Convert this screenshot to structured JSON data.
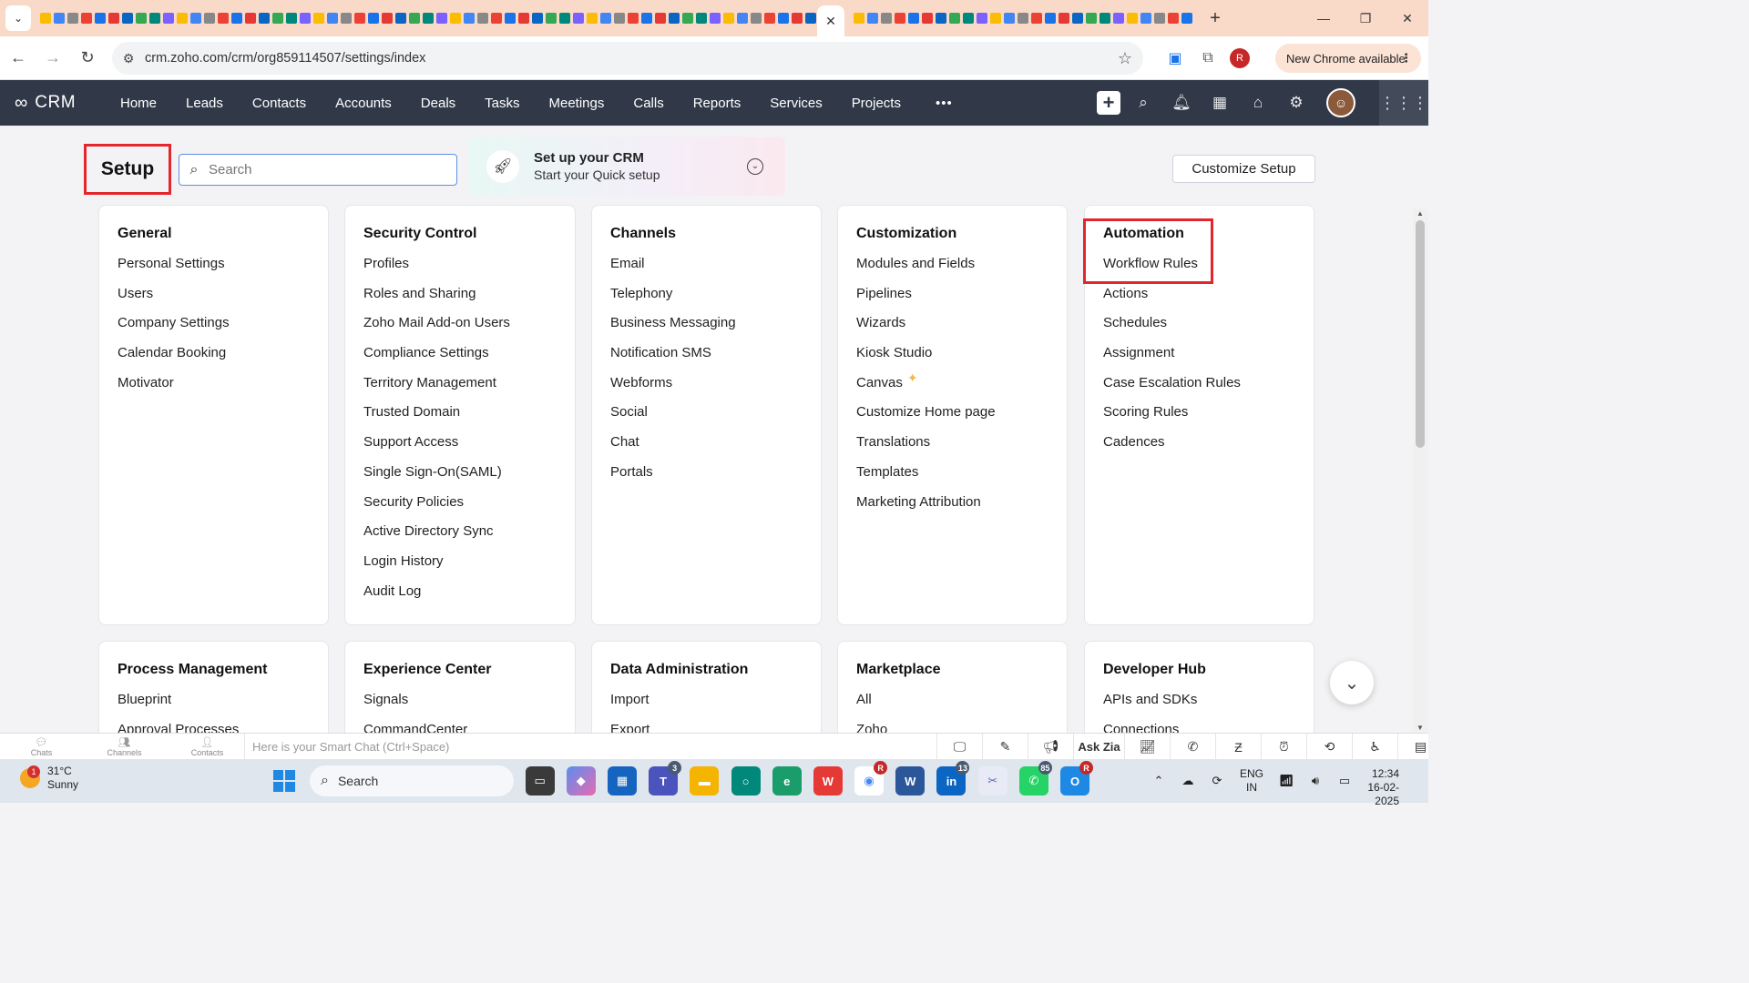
{
  "browser": {
    "active_tab_close": "✕",
    "url": "crm.zoho.com/crm/org859114507/settings/index",
    "new_chrome_label": "New Chrome available",
    "profile_initial": "R"
  },
  "crm": {
    "logo_text": "CRM",
    "nav_items": [
      "Home",
      "Leads",
      "Contacts",
      "Accounts",
      "Deals",
      "Tasks",
      "Meetings",
      "Calls",
      "Reports",
      "Services",
      "Projects"
    ],
    "more_label": "•••"
  },
  "setup": {
    "title": "Setup",
    "search_placeholder": "Search",
    "quick_setup_title": "Set up your CRM",
    "quick_setup_subtitle": "Start your Quick setup",
    "customize_button": "Customize Setup"
  },
  "cards": [
    {
      "title": "General",
      "items": [
        "Personal Settings",
        "Users",
        "Company Settings",
        "Calendar Booking",
        "Motivator"
      ]
    },
    {
      "title": "Security Control",
      "items": [
        "Profiles",
        "Roles and Sharing",
        "Zoho Mail Add-on Users",
        "Compliance Settings",
        "Territory Management",
        "Trusted Domain",
        "Support Access",
        "Single Sign-On(SAML)",
        "Security Policies",
        "Active Directory Sync",
        "Login History",
        "Audit Log"
      ]
    },
    {
      "title": "Channels",
      "items": [
        "Email",
        "Telephony",
        "Business Messaging",
        "Notification SMS",
        "Webforms",
        "Social",
        "Chat",
        "Portals"
      ]
    },
    {
      "title": "Customization",
      "items": [
        "Modules and Fields",
        "Pipelines",
        "Wizards",
        "Kiosk Studio",
        "Canvas",
        "Customize Home page",
        "Translations",
        "Templates",
        "Marketing Attribution"
      ]
    },
    {
      "title": "Automation",
      "items": [
        "Workflow Rules",
        "Actions",
        "Schedules",
        "Assignment",
        "Case Escalation Rules",
        "Scoring Rules",
        "Cadences"
      ]
    }
  ],
  "cards_row2": [
    {
      "title": "Process Management",
      "items": [
        "Blueprint",
        "Approval Processes"
      ]
    },
    {
      "title": "Experience Center",
      "items": [
        "Signals",
        "CommandCenter"
      ]
    },
    {
      "title": "Data Administration",
      "items": [
        "Import",
        "Export"
      ]
    },
    {
      "title": "Marketplace",
      "items": [
        "All",
        "Zoho"
      ]
    },
    {
      "title": "Developer Hub",
      "items": [
        "APIs and SDKs",
        "Connections"
      ]
    }
  ],
  "chatbar": {
    "items": [
      "Chats",
      "Channels",
      "Contacts"
    ],
    "placeholder": "Here is your Smart Chat (Ctrl+Space)",
    "ask_zia": "Ask Zia"
  },
  "taskbar": {
    "weather_temp": "31°C",
    "weather_desc": "Sunny",
    "weather_badge": "1",
    "search_label": "Search",
    "teams_count": "3",
    "linkedin_count": "13",
    "whatsapp_count": "85",
    "chrome_badge": "R",
    "outlook_badge": "R",
    "lang_top": "ENG",
    "lang_bottom": "IN",
    "time": "12:34",
    "date": "16-02-2025"
  }
}
